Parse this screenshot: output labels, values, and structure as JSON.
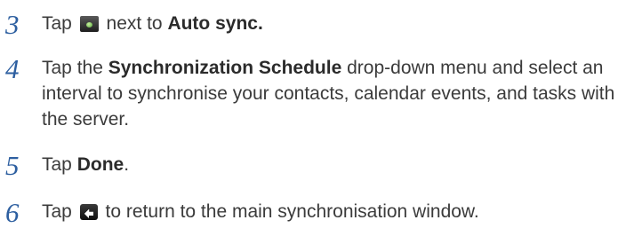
{
  "steps": [
    {
      "number": "3",
      "before_icon": "Tap",
      "icon": "auto-sync-toggle-icon",
      "after_icon": "next to",
      "bold": "Auto sync."
    },
    {
      "number": "4",
      "pre": "Tap the",
      "bold": "Synchronization Schedule",
      "post": "drop-down menu and select an interval to synchronise your contacts, calendar events, and tasks with the server."
    },
    {
      "number": "5",
      "pre": "Tap",
      "bold": "Done",
      "post": "."
    },
    {
      "number": "6",
      "before_icon": "Tap",
      "icon": "back-icon",
      "after_icon": "to return to the main synchronisation window."
    }
  ],
  "colors": {
    "step_number": "#2d5fa0",
    "body_text": "#3b3b3b",
    "bold_text": "#2b2b2b"
  }
}
